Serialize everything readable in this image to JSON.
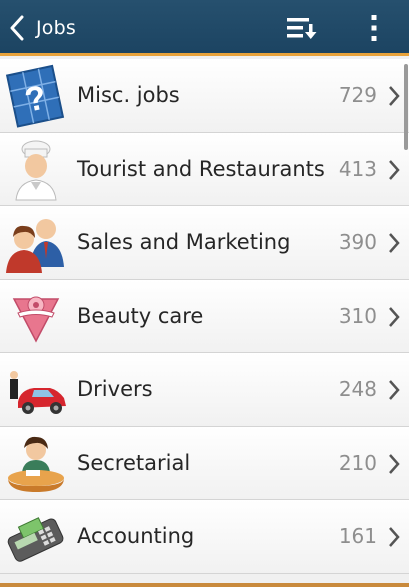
{
  "appbar": {
    "title": "Jobs",
    "back_icon": "chevron-left-icon",
    "sort_icon": "sort-icon",
    "menu_icon": "more-vertical-icon",
    "bg_color": "#1f4765",
    "accent_color": "#e8a23a"
  },
  "items": [
    {
      "label": "Misc. jobs",
      "count": "729",
      "icon": "question-map-icon"
    },
    {
      "label": "Tourist and Restaurants",
      "count": "413",
      "icon": "chef-icon"
    },
    {
      "label": "Sales and Marketing",
      "count": "390",
      "icon": "business-people-icon"
    },
    {
      "label": "Beauty care",
      "count": "310",
      "icon": "beauty-badge-icon"
    },
    {
      "label": "Drivers",
      "count": "248",
      "icon": "car-driver-icon"
    },
    {
      "label": "Secretarial",
      "count": "210",
      "icon": "secretary-icon"
    },
    {
      "label": "Accounting",
      "count": "161",
      "icon": "payment-terminal-icon"
    }
  ]
}
